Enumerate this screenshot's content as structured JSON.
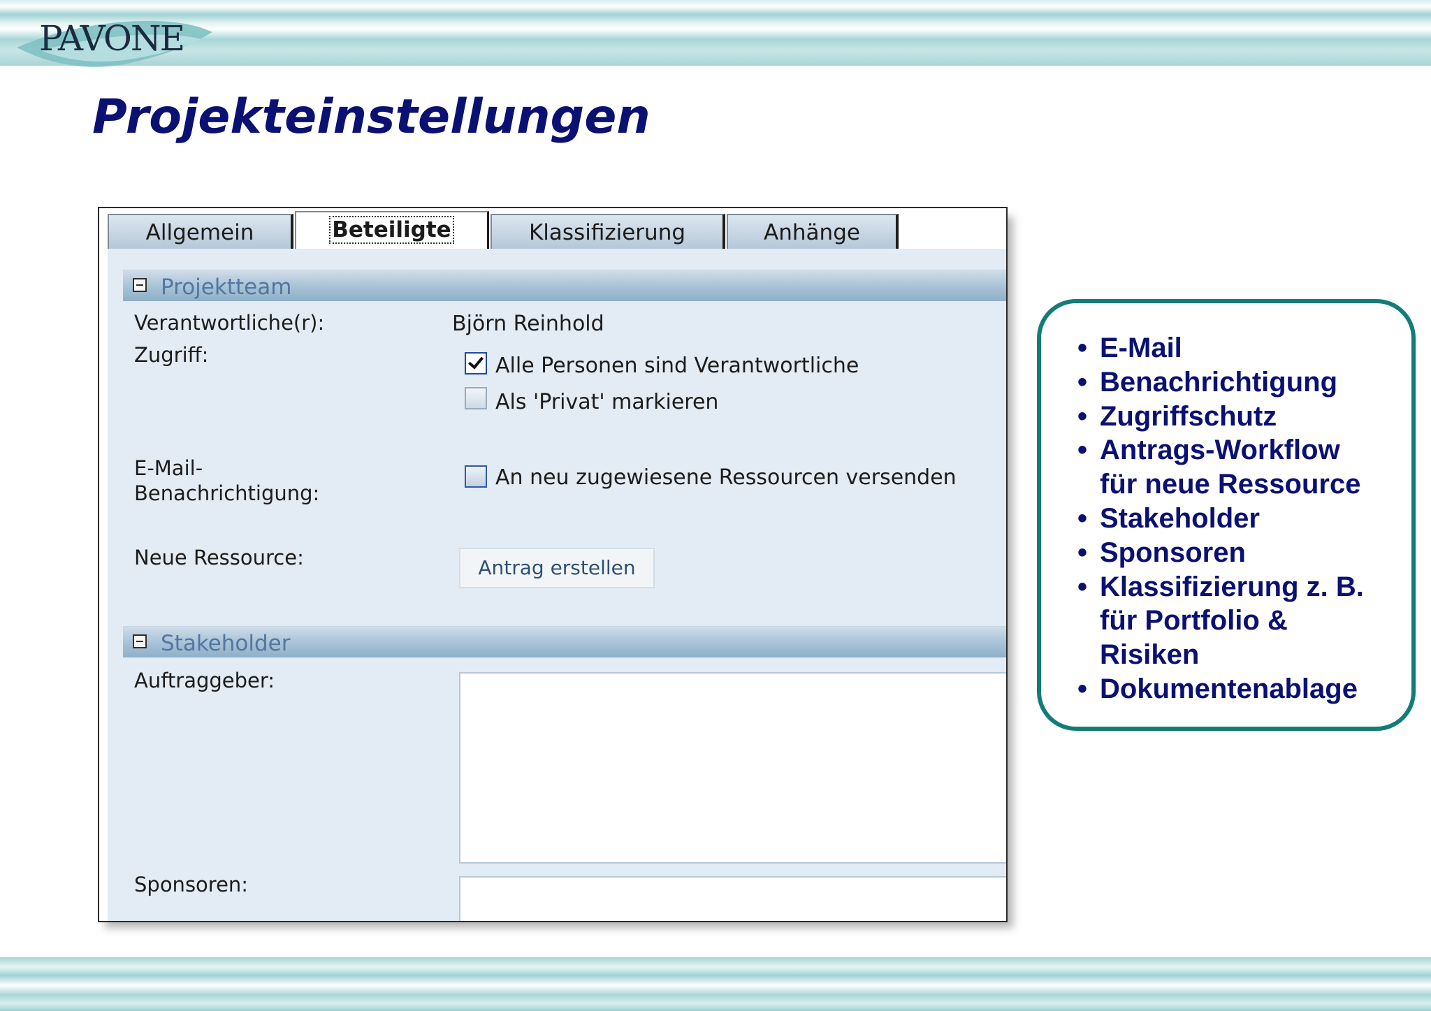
{
  "logo": {
    "text": "PAVONE"
  },
  "slide": {
    "title": "Projekteinstellungen"
  },
  "tabs": [
    {
      "label": "Allgemein"
    },
    {
      "label": "Beteiligte",
      "active": true
    },
    {
      "label": "Klassifizierung"
    },
    {
      "label": "Anhänge"
    }
  ],
  "projektteam": {
    "title": "Projektteam",
    "verantwortlich_label": "Verantwortliche(r):",
    "verantwortlich_value": "Björn Reinhold",
    "zugriff_label": "Zugriff:",
    "alle_personen_label": "Alle Personen sind Verantwortliche",
    "alle_personen_checked": true,
    "privat_label": "Als 'Privat' markieren",
    "privat_checked": false,
    "email_label_1": "E-Mail-",
    "email_label_2": "Benachrichtigung:",
    "email_option_label": "An neu zugewiesene Ressourcen versenden",
    "email_option_checked": false,
    "neue_ressource_label": "Neue Ressource:",
    "antrag_button": "Antrag erstellen"
  },
  "stakeholder": {
    "title": "Stakeholder",
    "auftraggeber_label": "Auftraggeber:",
    "auftraggeber_value": "",
    "sponsoren_label": "Sponsoren:",
    "sponsoren_value": ""
  },
  "features": [
    "E-Mail",
    "Benachrichtigung",
    "Zugriffschutz",
    "Antrags-Workflow\nfür neue Ressource",
    "Stakeholder",
    "Sponsoren",
    "Klassifizierung z. B.\nfür Portfolio &\nRisiken",
    "Dokumentenablage"
  ],
  "colors": {
    "title": "#0b1173",
    "callout_border": "#137c78",
    "panel_background": "#e3ebf4",
    "section_header": "#a7c1d6"
  }
}
